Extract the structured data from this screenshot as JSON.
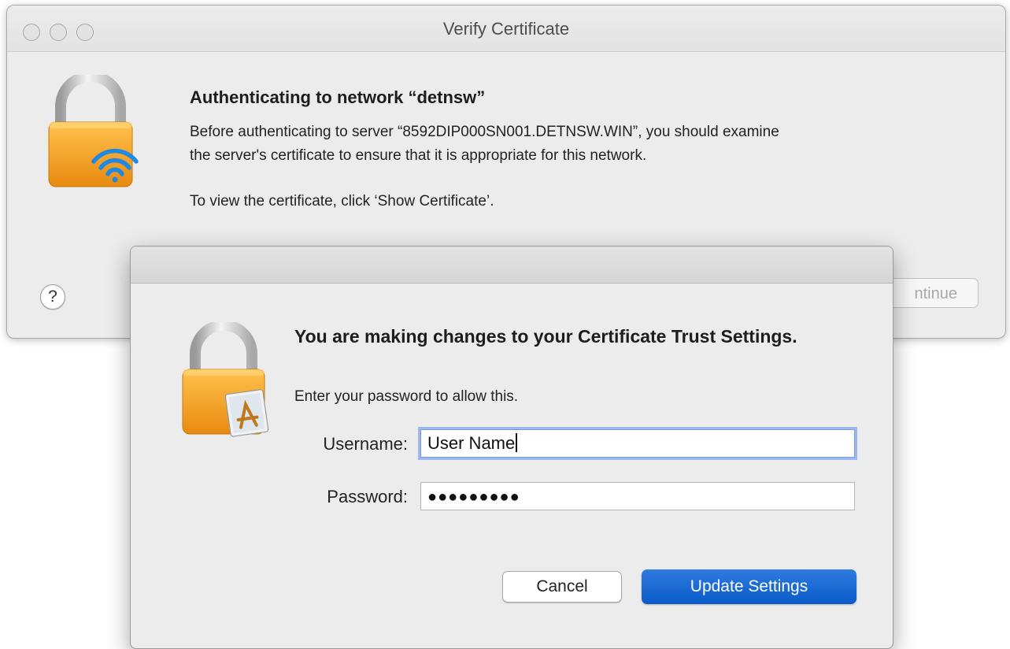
{
  "back_window": {
    "title": "Verify Certificate",
    "heading": "Authenticating to network “detnsw”",
    "body_line1": "Before authenticating to server “8592DIP000SN001.DETNSW.WIN”, you should examine",
    "body_line2": "the server's certificate to ensure that it is appropriate for this network.",
    "body_line3": "To view the certificate, click ‘Show Certificate’.",
    "help_label": "?",
    "continue_label": "ntinue"
  },
  "sheet": {
    "heading": "You are making changes to your Certificate Trust Settings.",
    "subtext": "Enter your password to allow this.",
    "username_label": "Username:",
    "username_value": "User Name",
    "password_label": "Password:",
    "password_value": "●●●●●●●●●",
    "cancel_label": "Cancel",
    "update_label": "Update Settings"
  },
  "colors": {
    "primary_button": "#0a5bc8",
    "lock_orange": "#f5a623",
    "wifi_blue": "#1e88e5",
    "focus_ring": "#9db8ee"
  },
  "icons": {
    "back_icon": "lock-wifi-icon",
    "sheet_icon": "lock-document-icon"
  }
}
